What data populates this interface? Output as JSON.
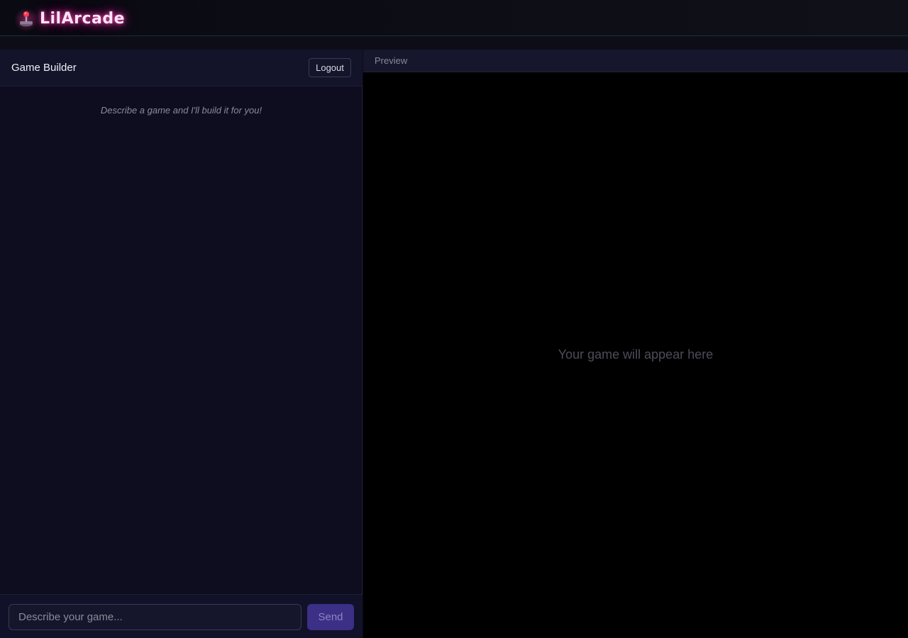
{
  "app": {
    "name": "LilArcade",
    "logo_icon": "joystick-icon",
    "accent_glow": "#ff3ca8"
  },
  "builder": {
    "title": "Game Builder",
    "logout_label": "Logout",
    "hint": "Describe a game and I'll build it for you!",
    "input_placeholder": "Describe your game...",
    "input_value": "",
    "send_label": "Send"
  },
  "preview": {
    "label": "Preview",
    "placeholder": "Your game will appear here"
  },
  "colors": {
    "send_button": "#3b2f86",
    "panel_bg": "#0e0d1f",
    "preview_bg": "#000000"
  }
}
